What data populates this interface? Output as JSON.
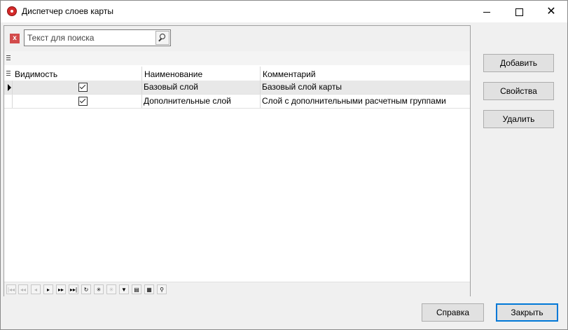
{
  "window": {
    "title": "Диспетчер слоев карты",
    "controls": {
      "minimize": "–",
      "maximize": "□",
      "close": "✕"
    }
  },
  "search": {
    "clear_label": "x",
    "placeholder": "Текст для поиска",
    "value": ""
  },
  "grid": {
    "columns": [
      "Видимость",
      "Наименование",
      "Комментарий"
    ],
    "rows": [
      {
        "visible": true,
        "name": "Базовый слой",
        "comment": "Базовый слой карты",
        "selected": true
      },
      {
        "visible": true,
        "name": "Дополнительные слой",
        "comment": "Слой с дополнительными расчетным группами",
        "selected": false
      }
    ]
  },
  "navigator": {
    "buttons": [
      {
        "icon": "first-icon",
        "glyph": "|◂◂",
        "enabled": false
      },
      {
        "icon": "prev-page-icon",
        "glyph": "◂◂",
        "enabled": false
      },
      {
        "icon": "prev-icon",
        "glyph": "◂",
        "enabled": false
      },
      {
        "icon": "next-icon",
        "glyph": "▸",
        "enabled": true
      },
      {
        "icon": "next-page-icon",
        "glyph": "▸▸",
        "enabled": true
      },
      {
        "icon": "last-icon",
        "glyph": "▸▸|",
        "enabled": true
      },
      {
        "icon": "refresh-icon",
        "glyph": "↻",
        "enabled": true
      },
      {
        "icon": "append-icon",
        "glyph": "✳",
        "enabled": true
      },
      {
        "icon": "insert-icon",
        "glyph": "✳",
        "enabled": false
      },
      {
        "icon": "filter-icon",
        "glyph": "▼",
        "enabled": true
      },
      {
        "icon": "export-icon",
        "glyph": "▤",
        "enabled": true
      },
      {
        "icon": "columns-icon",
        "glyph": "▦",
        "enabled": true
      },
      {
        "icon": "find-icon",
        "glyph": "⚲",
        "enabled": true
      }
    ]
  },
  "side_buttons": {
    "add": "Добавить",
    "properties": "Свойства",
    "delete": "Удалить"
  },
  "footer_buttons": {
    "help": "Справка",
    "close": "Закрыть"
  },
  "colors": {
    "accent": "#0078d7",
    "clear_button": "#d24b4b",
    "selected_row": "#e8e8e8"
  }
}
